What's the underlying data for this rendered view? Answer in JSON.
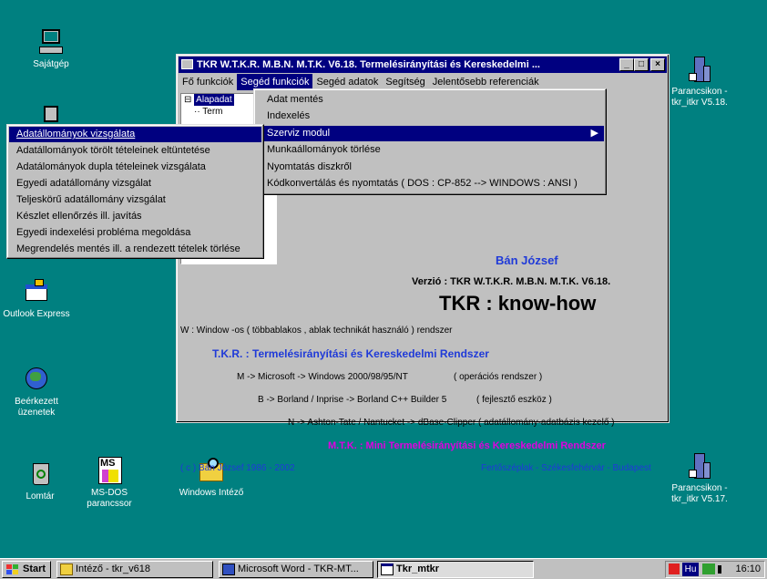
{
  "desktop": {
    "icons": [
      {
        "label": "Sajátgép"
      },
      {
        "label": "Outlook Express"
      },
      {
        "label": "Beérkezett üzenetek"
      },
      {
        "label": "Lomtár"
      },
      {
        "label": "MS-DOS parancssor"
      },
      {
        "label": "Windows Intéző"
      },
      {
        "label": "Parancsikon - tkr_itkr V5.18."
      },
      {
        "label": "Parancsikon - tkr_itkr V5.17."
      }
    ],
    "ms_icon_text": "MS"
  },
  "window": {
    "title": "TKR W.T.K.R. M.B.N. M.T.K. V6.18. Termelésirányítási és Kereskedelmi ...",
    "menu": [
      "Fő funkciók",
      "Segéd funkciók",
      "Segéd adatok",
      "Segítség",
      "Jelentősebb referenciák"
    ],
    "tree": [
      "Alapadat",
      "Term"
    ],
    "content": {
      "author": "Bán József",
      "version": "Verzió : TKR W.T.K.R. M.B.N. M.T.K. V6.18.",
      "knowhow": "TKR :  know-how",
      "w_line": "W : Window -os ( többablakos , ablak technikát használó ) rendszer",
      "tkr_line": "T.K.R. : Termelésirányítási és Kereskedelmi Rendszer",
      "m_line": "M -> Microsoft -> Windows 2000/98/95/NT",
      "m_note": "( operációs rendszer )",
      "b_line": "B -> Borland / Inprise -> Borland C++ Builder 5",
      "b_note": "( fejlesztő eszköz )",
      "n_line": "N -> Ashton-Tate / Nantucket -> dBase-Clipper   ( adatállomány-adatbázis kezelő )",
      "mtk_line": "M.T.K.  : Mini Termelésirányítási és Kereskedelmi Rendszer",
      "copyright": "( c ) Bán József 1986 - 2002",
      "places": "Fertőszéplak - Székesfehérvár - Budapest"
    }
  },
  "submenu": {
    "items": [
      "Adat mentés",
      "Indexelés",
      "Szerviz modul",
      "Munkaállományok törlése",
      "Nyomtatás diszkről",
      "Kódkonvertálás és nyomtatás  ( DOS : CP-852 --> WINDOWS : ANSI )"
    ],
    "arrow": "▶"
  },
  "popup": {
    "items": [
      "Adatállományok vizsgálata",
      "Adatállományok törölt tételeinek eltüntetése",
      "Adatálományok dupla tételeinek vizsgálata",
      "Egyedi adatállomány vizsgálat",
      "Teljeskörű adatállomány vizsgálat",
      "Készlet ellenőrzés ill. javítás",
      "Egyedi indexelési probléma megoldása",
      "Megrendelés mentés ill. a rendezett tételek törlése"
    ]
  },
  "taskbar": {
    "start": "Start",
    "buttons": [
      "Intéző - tkr_v618",
      "Microsoft Word - TKR-MT...",
      "Tkr_mtkr"
    ],
    "tray_lang": "Hu",
    "clock": "16:10"
  },
  "colors": {
    "desktop": "#008080",
    "title": "#000080",
    "blue_text": "#1f3ad8",
    "magenta": "#e000e0"
  }
}
